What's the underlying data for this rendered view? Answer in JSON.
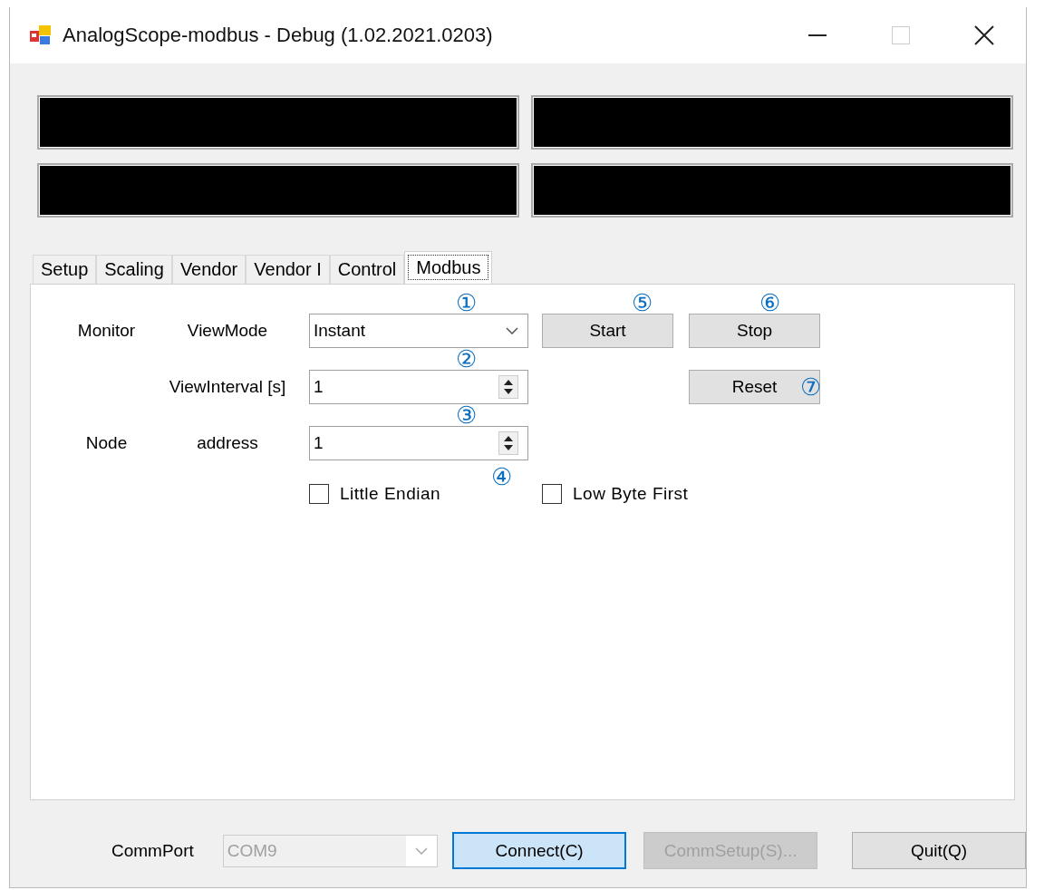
{
  "window": {
    "title": "AnalogScope-modbus - Debug (1.02.2021.0203)"
  },
  "tabs": [
    {
      "label": "Setup",
      "selected": false
    },
    {
      "label": "Scaling",
      "selected": false
    },
    {
      "label": "Vendor",
      "selected": false
    },
    {
      "label": "Vendor I",
      "selected": false
    },
    {
      "label": "Control",
      "selected": false
    },
    {
      "label": "Modbus",
      "selected": true
    }
  ],
  "modbus": {
    "monitor_label": "Monitor",
    "node_label": "Node",
    "view_mode": {
      "label": "ViewMode",
      "value": "Instant"
    },
    "view_interval": {
      "label": "ViewInterval [s]",
      "value": "1"
    },
    "address": {
      "label": "address",
      "value": "1"
    },
    "checkboxes": [
      {
        "label": "Little Endian",
        "checked": false
      },
      {
        "label": "Low Byte First",
        "checked": false
      }
    ],
    "buttons": [
      {
        "label": "Start"
      },
      {
        "label": "Stop"
      },
      {
        "label": "Reset"
      }
    ]
  },
  "callouts": [
    "①",
    "②",
    "③",
    "④",
    "⑤",
    "⑥",
    "⑦"
  ],
  "bottom": {
    "commport": {
      "label": "CommPort",
      "value": "COM9",
      "disabled": true
    },
    "buttons": [
      {
        "label": "Connect(C)",
        "disabled": false,
        "focused": true
      },
      {
        "label": "CommSetup(S)...",
        "disabled": true,
        "focused": false
      },
      {
        "label": "Quit(Q)",
        "disabled": false,
        "focused": false
      }
    ]
  }
}
